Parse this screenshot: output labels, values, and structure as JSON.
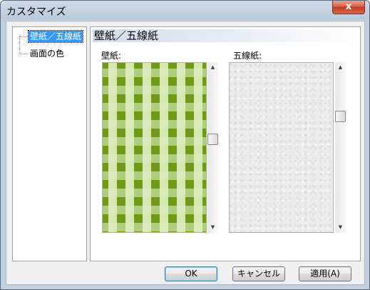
{
  "window": {
    "title": "カスタマイズ",
    "close_glyph": "x"
  },
  "tree": {
    "items": [
      {
        "label": "壁紙／五線紙",
        "selected": true
      },
      {
        "label": "画面の色",
        "selected": false
      }
    ]
  },
  "panel": {
    "header": "壁紙／五線紙",
    "wallpaper": {
      "label": "壁紙:",
      "pattern": "green-gingham",
      "scroll": {
        "up": "▲",
        "down": "▼"
      }
    },
    "staff_paper": {
      "label": "五線紙:",
      "pattern": "white-paper",
      "scroll": {
        "up": "▲",
        "down": "▼"
      }
    }
  },
  "buttons": {
    "ok": "OK",
    "cancel": "キャンセル",
    "apply": "適用(A)"
  },
  "colors": {
    "selection": "#3399ff",
    "gingham": "#6e9a18",
    "paper": "#ebebeb"
  }
}
